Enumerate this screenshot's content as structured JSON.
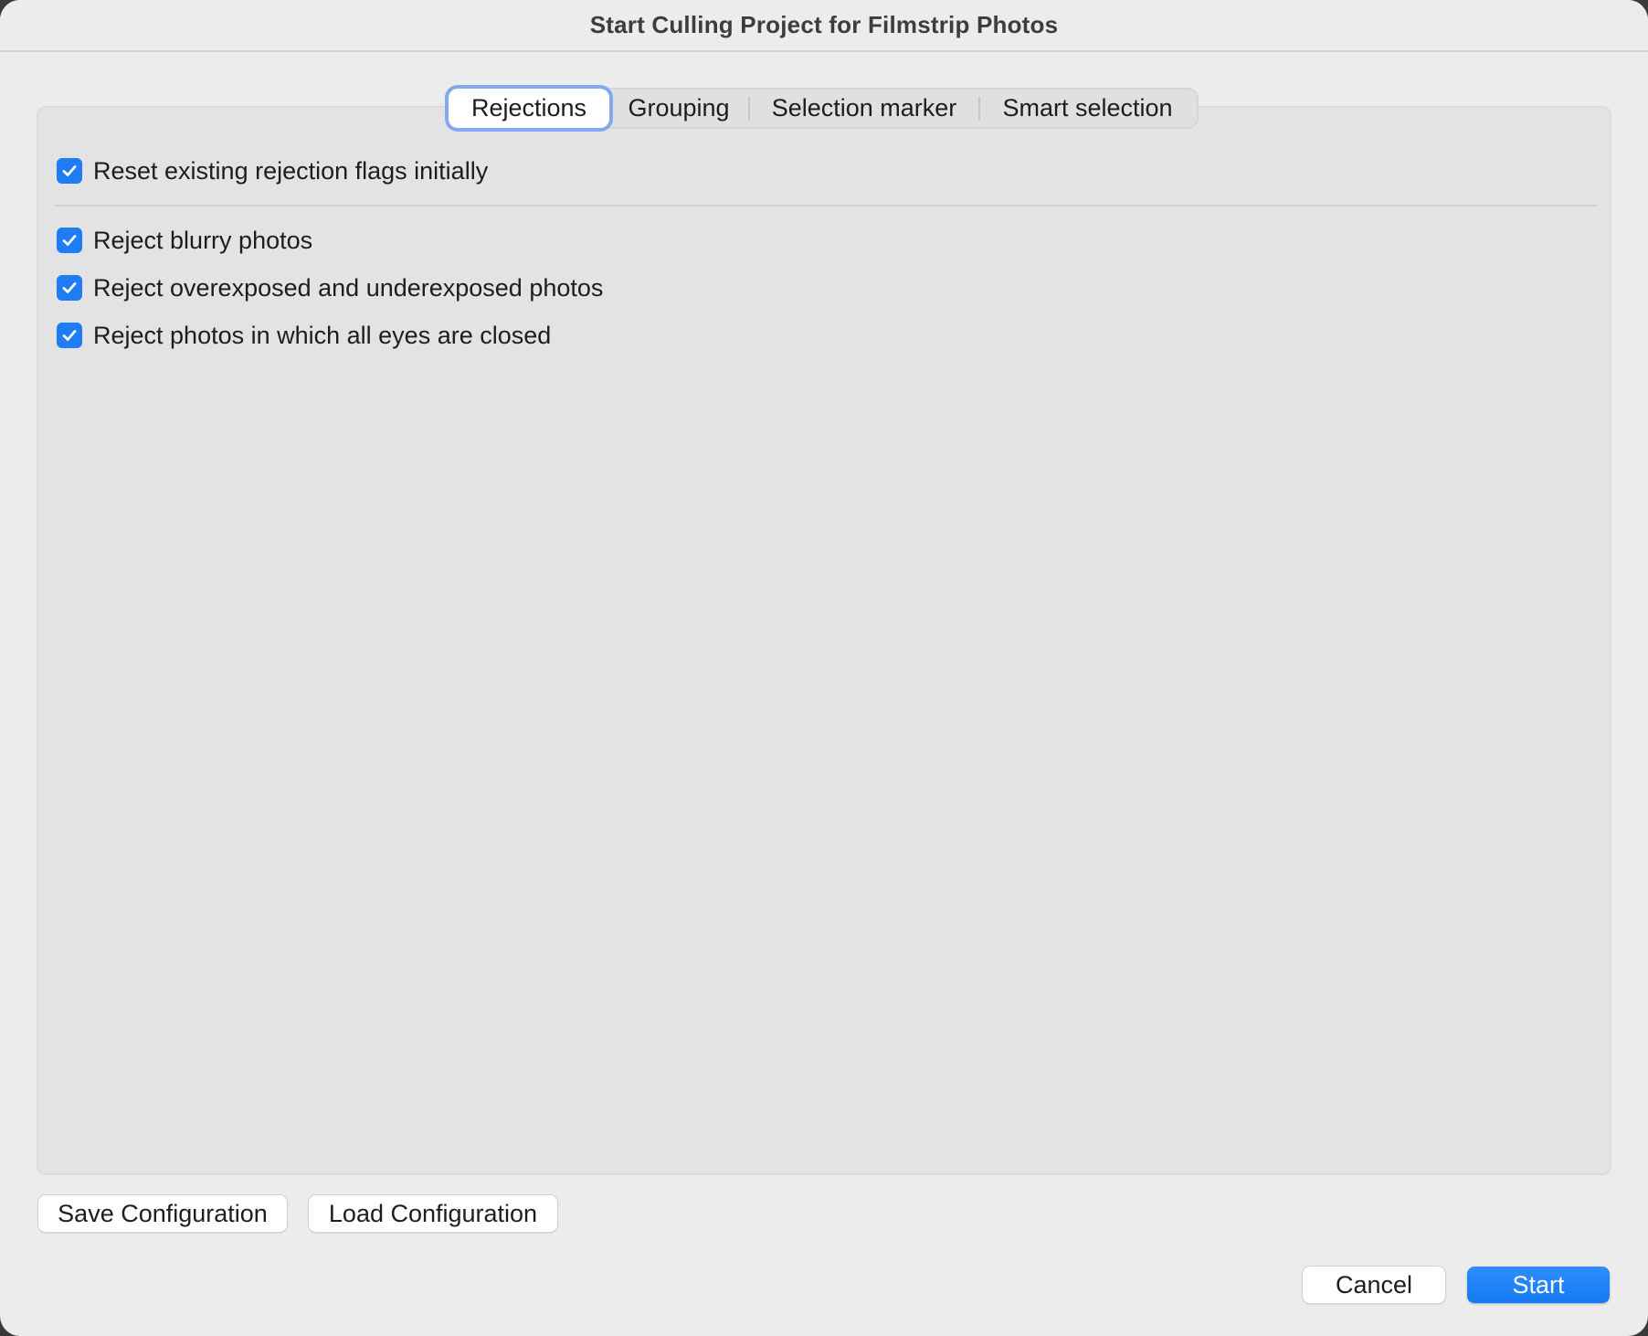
{
  "window": {
    "title": "Start Culling Project for Filmstrip Photos"
  },
  "tabs": [
    {
      "label": "Rejections",
      "active": true
    },
    {
      "label": "Grouping",
      "active": false
    },
    {
      "label": "Selection marker",
      "active": false
    },
    {
      "label": "Smart selection",
      "active": false
    }
  ],
  "rejections": {
    "reset_flags": {
      "label": "Reset existing rejection flags initially",
      "checked": true
    },
    "options": [
      {
        "label": "Reject blurry photos",
        "checked": true
      },
      {
        "label": "Reject overexposed and underexposed photos",
        "checked": true
      },
      {
        "label": "Reject photos in which all eyes are closed",
        "checked": true
      }
    ]
  },
  "buttons": {
    "save_config": "Save Configuration",
    "load_config": "Load Configuration",
    "cancel": "Cancel",
    "start": "Start"
  },
  "colors": {
    "accent": "#1e7cf5",
    "focus_ring": "#84a8ee"
  }
}
